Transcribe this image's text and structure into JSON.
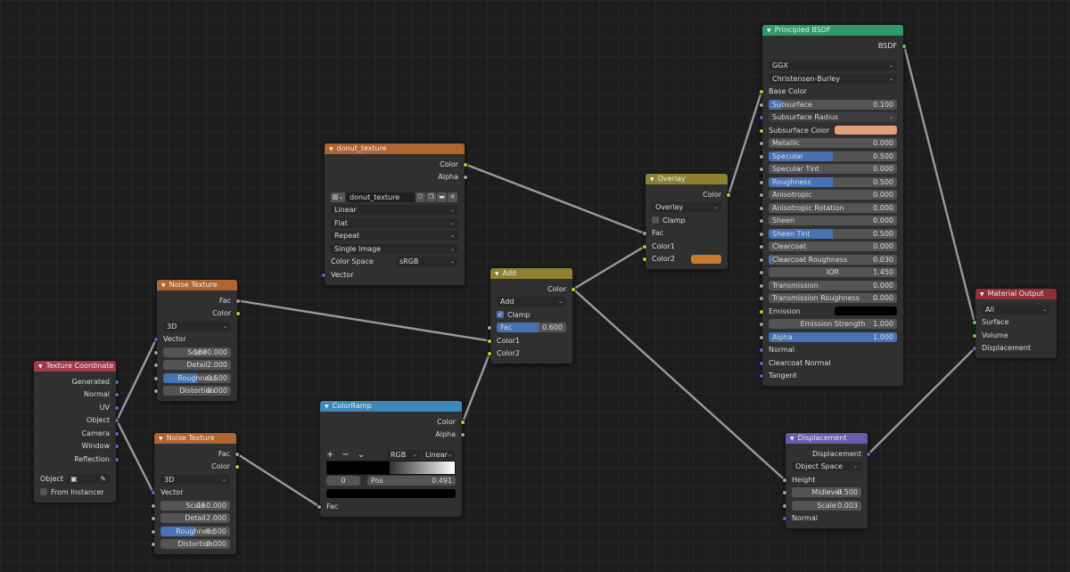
{
  "editor": "Shader Editor",
  "colors": {
    "input": "#a33a45",
    "texture": "#b0642f",
    "color": "#8c8231",
    "converter": "#3e88b8",
    "shader": "#2e9a67",
    "vector": "#6b5aad",
    "output": "#8e2f3a",
    "socket_color": "#c7c729",
    "socket_float": "#a1a1a1",
    "socket_vector": "#6363c7",
    "socket_shader": "#63c763",
    "wire": "#9a9a9a",
    "slider_fill": "#4772b3"
  },
  "nodes": [
    {
      "id": "texcoord",
      "title": "Texture Coordinate",
      "kind": "input",
      "rows": [
        {
          "t": "out",
          "label": "Generated",
          "s": "vector"
        },
        {
          "t": "out",
          "label": "Normal",
          "s": "vector"
        },
        {
          "t": "out",
          "label": "UV",
          "s": "vector"
        },
        {
          "t": "out",
          "label": "Object",
          "s": "vector"
        },
        {
          "t": "out",
          "label": "Camera",
          "s": "vector"
        },
        {
          "t": "out",
          "label": "Window",
          "s": "vector"
        },
        {
          "t": "out",
          "label": "Reflection",
          "s": "vector"
        },
        {
          "t": "gap"
        },
        {
          "t": "field",
          "label": "Object",
          "icon": "object-icon"
        },
        {
          "t": "check",
          "label": "From Instancer",
          "checked": false
        }
      ]
    },
    {
      "id": "noise1",
      "title": "Noise Texture",
      "kind": "texture",
      "rows": [
        {
          "t": "out",
          "label": "Fac",
          "s": "float"
        },
        {
          "t": "out",
          "label": "Color",
          "s": "color"
        },
        {
          "t": "select",
          "value": "3D"
        },
        {
          "t": "in",
          "label": "Vector",
          "s": "vector"
        },
        {
          "t": "slider",
          "label": "Scale",
          "value": "1500.000",
          "fill": 0,
          "s": "float",
          "center": true
        },
        {
          "t": "slider",
          "label": "Detail",
          "value": "2.000",
          "fill": 0,
          "s": "float",
          "center": true
        },
        {
          "t": "slider",
          "label": "Roughness",
          "value": "0.500",
          "fill": 0.5,
          "s": "float",
          "center": true
        },
        {
          "t": "slider",
          "label": "Distortion",
          "value": "0.000",
          "fill": 0,
          "s": "float",
          "center": true
        }
      ]
    },
    {
      "id": "noise2",
      "title": "Noise Texture",
      "kind": "texture",
      "rows": [
        {
          "t": "out",
          "label": "Fac",
          "s": "float"
        },
        {
          "t": "out",
          "label": "Color",
          "s": "color"
        },
        {
          "t": "select",
          "value": "3D"
        },
        {
          "t": "in",
          "label": "Vector",
          "s": "vector"
        },
        {
          "t": "slider",
          "label": "Scale",
          "value": "150.000",
          "fill": 0,
          "s": "float",
          "center": true
        },
        {
          "t": "slider",
          "label": "Detail",
          "value": "2.000",
          "fill": 0,
          "s": "float",
          "center": true
        },
        {
          "t": "slider",
          "label": "Roughness",
          "value": "0.500",
          "fill": 0.5,
          "s": "float",
          "center": true
        },
        {
          "t": "slider",
          "label": "Distortion",
          "value": "0.000",
          "fill": 0,
          "s": "float",
          "center": true
        }
      ]
    },
    {
      "id": "donut",
      "title": "donut_texture",
      "kind": "texture",
      "rows": [
        {
          "t": "out",
          "label": "Color",
          "s": "color"
        },
        {
          "t": "out",
          "label": "Alpha",
          "s": "float"
        },
        {
          "t": "gap"
        },
        {
          "t": "image",
          "value": "donut_texture"
        },
        {
          "t": "select",
          "value": "Linear"
        },
        {
          "t": "select",
          "value": "Flat"
        },
        {
          "t": "select",
          "value": "Repeat"
        },
        {
          "t": "select",
          "value": "Single Image"
        },
        {
          "t": "labelselect",
          "label": "Color Space",
          "value": "sRGB"
        },
        {
          "t": "in",
          "label": "Vector",
          "s": "vector"
        }
      ]
    },
    {
      "id": "ramp",
      "title": "ColorRamp",
      "kind": "converter",
      "rows": [
        {
          "t": "out",
          "label": "Color",
          "s": "color"
        },
        {
          "t": "out",
          "label": "Alpha",
          "s": "float"
        },
        {
          "t": "gap"
        },
        {
          "t": "rampctl",
          "mode": "RGB",
          "interp": "Linear"
        },
        {
          "t": "rampbar",
          "position": 0.491
        },
        {
          "t": "ramppos",
          "index": "0",
          "label": "Pos",
          "value": "0.491"
        },
        {
          "t": "rampcolor",
          "color": "#000000"
        },
        {
          "t": "in",
          "label": "Fac",
          "s": "float"
        }
      ]
    },
    {
      "id": "add",
      "title": "Add",
      "kind": "color",
      "rows": [
        {
          "t": "out",
          "label": "Color",
          "s": "color"
        },
        {
          "t": "select",
          "value": "Add"
        },
        {
          "t": "check",
          "label": "Clamp",
          "checked": true
        },
        {
          "t": "slider",
          "label": "Fac",
          "value": "0.600",
          "fill": 0.6,
          "s": "float"
        },
        {
          "t": "in",
          "label": "Color1",
          "s": "color"
        },
        {
          "t": "in",
          "label": "Color2",
          "s": "color"
        }
      ]
    },
    {
      "id": "overlay",
      "title": "Overlay",
      "kind": "color",
      "rows": [
        {
          "t": "out",
          "label": "Color",
          "s": "color"
        },
        {
          "t": "select",
          "value": "Overlay"
        },
        {
          "t": "check",
          "label": "Clamp",
          "checked": false
        },
        {
          "t": "in",
          "label": "Fac",
          "s": "float"
        },
        {
          "t": "in",
          "label": "Color1",
          "s": "color"
        },
        {
          "t": "color",
          "label": "Color2",
          "color": "#c87a2a",
          "s": "color"
        }
      ]
    },
    {
      "id": "bsdf",
      "title": "Principled BSDF",
      "kind": "shader",
      "rows": [
        {
          "t": "out",
          "label": "BSDF",
          "s": "shader"
        },
        {
          "t": "gap"
        },
        {
          "t": "select",
          "value": "GGX"
        },
        {
          "t": "select",
          "value": "Christensen-Burley"
        },
        {
          "t": "in",
          "label": "Base Color",
          "s": "color"
        },
        {
          "t": "slider",
          "label": "Subsurface",
          "value": "0.100",
          "fill": 0.1,
          "s": "float"
        },
        {
          "t": "select",
          "value": "Subsurface Radius",
          "s": "vector",
          "light": true
        },
        {
          "t": "color",
          "label": "Subsurface Color",
          "color": "#e0a07a",
          "s": "color"
        },
        {
          "t": "slider",
          "label": "Metallic",
          "value": "0.000",
          "fill": 0,
          "s": "float"
        },
        {
          "t": "slider",
          "label": "Specular",
          "value": "0.500",
          "fill": 0.5,
          "s": "float"
        },
        {
          "t": "slider",
          "label": "Specular Tint",
          "value": "0.000",
          "fill": 0,
          "s": "float"
        },
        {
          "t": "slider",
          "label": "Roughness",
          "value": "0.500",
          "fill": 0.5,
          "s": "float"
        },
        {
          "t": "slider",
          "label": "Anisotropic",
          "value": "0.000",
          "fill": 0,
          "s": "float"
        },
        {
          "t": "slider",
          "label": "Anisotropic Rotation",
          "value": "0.000",
          "fill": 0,
          "s": "float"
        },
        {
          "t": "slider",
          "label": "Sheen",
          "value": "0.000",
          "fill": 0,
          "s": "float"
        },
        {
          "t": "slider",
          "label": "Sheen Tint",
          "value": "0.500",
          "fill": 0.5,
          "s": "float"
        },
        {
          "t": "slider",
          "label": "Clearcoat",
          "value": "0.000",
          "fill": 0,
          "s": "float"
        },
        {
          "t": "slider",
          "label": "Clearcoat Roughness",
          "value": "0.030",
          "fill": 0.03,
          "s": "float"
        },
        {
          "t": "slider",
          "label": "IOR",
          "value": "1.450",
          "fill": 0,
          "s": "float",
          "center": true
        },
        {
          "t": "slider",
          "label": "Transmission",
          "value": "0.000",
          "fill": 0,
          "s": "float"
        },
        {
          "t": "slider",
          "label": "Transmission Roughness",
          "value": "0.000",
          "fill": 0,
          "s": "float"
        },
        {
          "t": "color",
          "label": "Emission",
          "color": "#000000",
          "s": "color"
        },
        {
          "t": "slider",
          "label": "Emission Strength",
          "value": "1.000",
          "fill": 0,
          "s": "float",
          "center": true
        },
        {
          "t": "slider",
          "label": "Alpha",
          "value": "1.000",
          "fill": 1,
          "s": "float"
        },
        {
          "t": "in",
          "label": "Normal",
          "s": "vector"
        },
        {
          "t": "in",
          "label": "Clearcoat Normal",
          "s": "vector"
        },
        {
          "t": "in",
          "label": "Tangent",
          "s": "vector"
        }
      ]
    },
    {
      "id": "disp",
      "title": "Displacement",
      "kind": "vector",
      "rows": [
        {
          "t": "out",
          "label": "Displacement",
          "s": "vector"
        },
        {
          "t": "select",
          "value": "Object Space"
        },
        {
          "t": "in",
          "label": "Height",
          "s": "float"
        },
        {
          "t": "slider",
          "label": "Midlevel",
          "value": "0.500",
          "fill": 0,
          "s": "float",
          "center": true
        },
        {
          "t": "slider",
          "label": "Scale",
          "value": "0.003",
          "fill": 0,
          "s": "float",
          "center": true
        },
        {
          "t": "in",
          "label": "Normal",
          "s": "vector"
        }
      ]
    },
    {
      "id": "matout",
      "title": "Material Output",
      "kind": "output",
      "rows": [
        {
          "t": "select",
          "value": "All"
        },
        {
          "t": "in",
          "label": "Surface",
          "s": "shader"
        },
        {
          "t": "in",
          "label": "Volume",
          "s": "shader"
        },
        {
          "t": "in",
          "label": "Displacement",
          "s": "vector"
        }
      ]
    }
  ],
  "links": [
    [
      "texcoord",
      "Object",
      "noise1",
      "Vector"
    ],
    [
      "texcoord",
      "Object",
      "noise2",
      "Vector"
    ],
    [
      "noise1",
      "Fac",
      "add",
      "Color1"
    ],
    [
      "noise2",
      "Fac",
      "ramp",
      "Fac"
    ],
    [
      "ramp",
      "Color",
      "add",
      "Color2"
    ],
    [
      "donut",
      "Color",
      "overlay",
      "Fac"
    ],
    [
      "add",
      "Color",
      "overlay",
      "Color1"
    ],
    [
      "add",
      "Color",
      "disp",
      "Height"
    ],
    [
      "overlay",
      "Color",
      "bsdf",
      "Base Color"
    ],
    [
      "bsdf",
      "BSDF",
      "matout",
      "Surface"
    ],
    [
      "disp",
      "Displacement",
      "matout",
      "Displacement"
    ]
  ]
}
